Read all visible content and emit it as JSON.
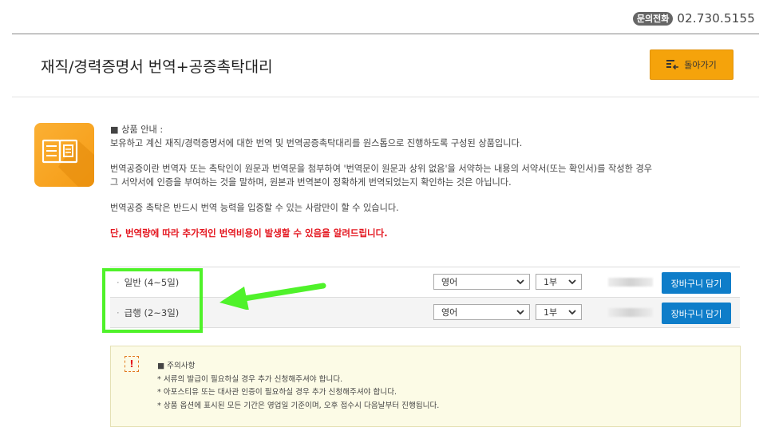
{
  "header": {
    "phone_badge": "문의전화",
    "phone_number": "02.730.5155"
  },
  "title": {
    "text": "재직/경력증명서 번역+공증촉탁대리",
    "back_label": "돌아가기"
  },
  "description": {
    "heading": "■ 상품 안내 :",
    "line1": "보유하고 계신 재직/경력증명서에 대한 번역 및 번역공증촉탁대리를 원스톱으로 진행하도록 구성된 상품입니다.",
    "line2": "번역공증이란 번역자 또는 촉탁인이 원문과 번역문을 첨부하여 '번역문이 원문과 상위 없음'을 서약하는 내용의 서약서(또는 확인서)를 작성한 경우",
    "line3": "그 서약서에 인증을 부여하는 것을 말하며, 원본과 번역본이 정확하게 번역되었는지 확인하는 것은 아닙니다.",
    "line4": "번역공증 촉탁은 반드시 번역 능력을 입증할 수 있는 사람만이 할 수 있습니다.",
    "warning": "단, 번역량에 따라 추가적인 번역비용이 발생할 수 있음을 알려드립니다."
  },
  "options": [
    {
      "label": "일반 (4~5일)",
      "language": "영어",
      "quantity": "1부",
      "cart_label": "장바구니 담기"
    },
    {
      "label": "급행 (2~3일)",
      "language": "영어",
      "quantity": "1부",
      "cart_label": "장바구니 담기"
    }
  ],
  "notice": {
    "icon": "!",
    "title": "■ 주의사항",
    "items": [
      "* 서류의 발급이 필요하실 경우 추가 신청해주셔야 합니다.",
      "* 아포스티유 또는 대사관 인증이 필요하실 경우 추가 신청해주셔야 합니다.",
      "* 상품 옵션에 표시된 모든 기간은 영업일 기준이며, 오후 접수시 다음날부터 진행됩니다."
    ]
  },
  "colors": {
    "accent": "#f5a30b",
    "cart_button": "#0e7dc9",
    "warning": "#e4161f",
    "highlight": "#4ff22a"
  },
  "icons": [
    "book-icon",
    "list-back-icon",
    "chevron-down-icon",
    "arrow-left-icon",
    "exclamation-icon"
  ]
}
